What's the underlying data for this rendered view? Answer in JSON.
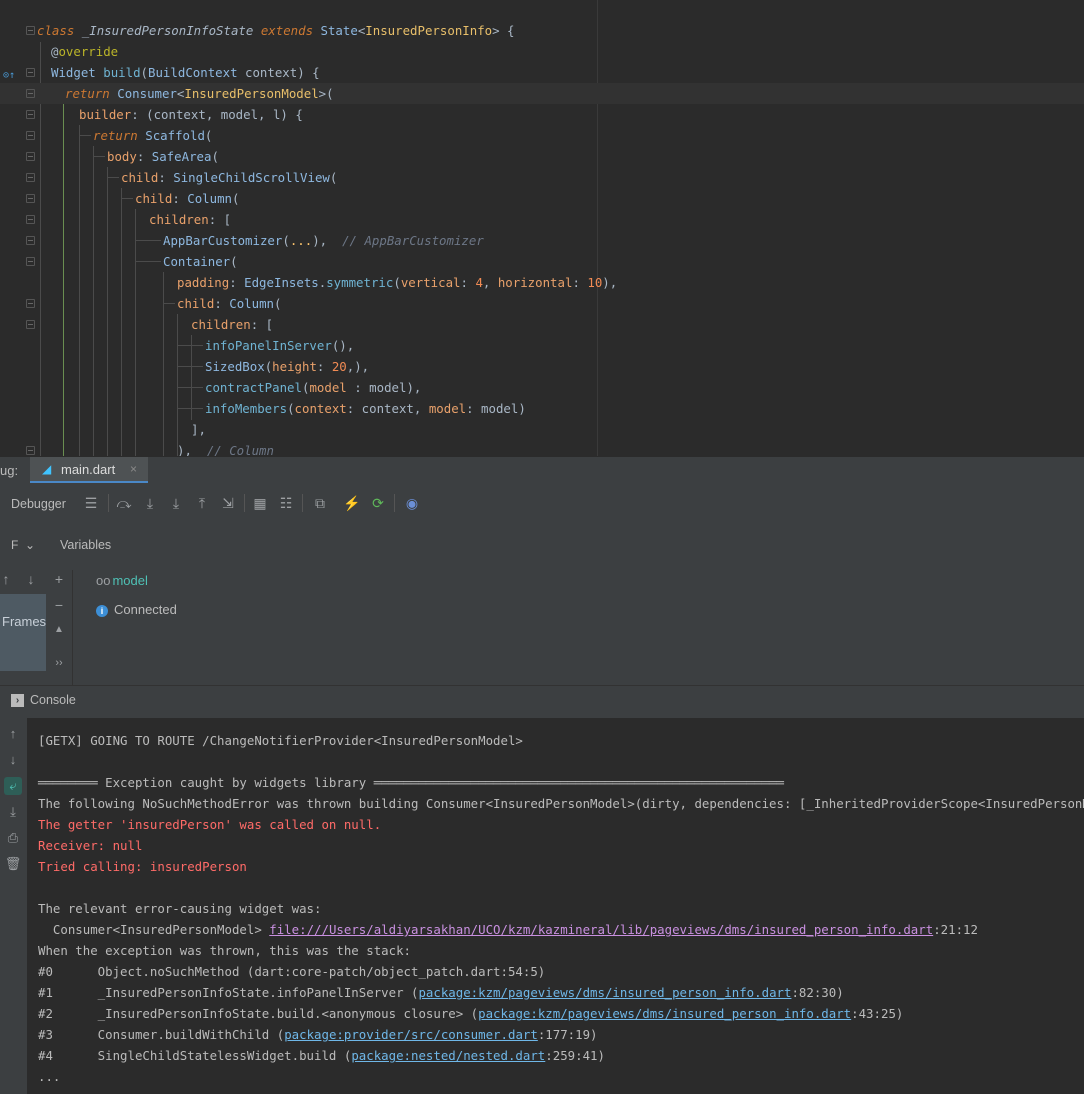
{
  "editor": {
    "lines": {
      "l1": {
        "kw": "class",
        "cls": "_InsuredPersonInfoState",
        "kw2": "extends",
        "ty": "State",
        "lt": "<",
        "tp": "InsuredPersonInfo",
        "rest": "> {"
      },
      "l2": {
        "at": "@",
        "an": "override"
      },
      "l3": {
        "ty": "Widget",
        "fn": "build",
        "rest1": "(",
        "ty2": "BuildContext",
        "rest2": " context) {"
      },
      "l4": {
        "kw": "return",
        "ty": "Consumer",
        "lt": "<",
        "tp": "InsuredPersonModel",
        "rest": ">("
      },
      "l5": {
        "prm": "builder",
        "rest": ": (context, model, l) {"
      },
      "l6": {
        "kw": "return",
        "ty": "Scaffold",
        "rest": "("
      },
      "l7": {
        "prm": "body",
        "rest": ": ",
        "ty": "SafeArea",
        "rest2": "("
      },
      "l8": {
        "prm": "child",
        "rest": ": ",
        "ty": "SingleChildScrollView",
        "rest2": "("
      },
      "l9": {
        "prm": "child",
        "rest": ": ",
        "ty": "Column",
        "rest2": "("
      },
      "l10": {
        "prm": "children",
        "rest": ": ["
      },
      "l11": {
        "ty": "AppBarCustomizer",
        "mid": "(",
        "dots": "...",
        "rest": "),",
        "cm": "// AppBarCustomizer"
      },
      "l12": {
        "ty": "Container",
        "rest": "("
      },
      "l13": {
        "prm": "padding",
        "rest": ": ",
        "ty": "EdgeInsets",
        "dot": ".",
        "fn": "symmetric",
        "p1": "(",
        "prm2": "vertical",
        "c1": ": ",
        "n1": "4",
        "c2": ", ",
        "prm3": "horizontal",
        "c3": ": ",
        "n2": "10",
        "end": "),"
      },
      "l14": {
        "prm": "child",
        "rest": ": ",
        "ty": "Column",
        "rest2": "("
      },
      "l15": {
        "prm": "children",
        "rest": ": ["
      },
      "l16": {
        "fn": "infoPanelInServer",
        "rest": "(),"
      },
      "l17": {
        "ty": "SizedBox",
        "p1": "(",
        "prm": "height",
        "c1": ": ",
        "n": "20",
        "rest": ",),"
      },
      "l18": {
        "fn": "contractPanel",
        "p1": "(",
        "prm": "model",
        "c1": " : model),",
        "rest": ""
      },
      "l19": {
        "fn": "infoMembers",
        "p1": "(",
        "prm": "context",
        "c1": ": context, ",
        "prm2": "model",
        "c2": ": model)"
      },
      "l20": {
        "rest": "],"
      },
      "l21": {
        "rest": "),",
        "cm": "// Column"
      }
    }
  },
  "debug_bar": {
    "label": "ug:",
    "tab_label": "main.dart",
    "close": "×"
  },
  "debugger": {
    "title": "Debugger",
    "variables_header": "Variables",
    "frames_dropdown": "F",
    "frames_tab": "Frames",
    "variables": [
      {
        "name": "model"
      },
      {
        "name": "Connected"
      }
    ]
  },
  "console": {
    "title": "Console",
    "lines": {
      "c1": "[GETX] GOING TO ROUTE /ChangeNotifierProvider<InsuredPersonModel>",
      "c2": "════════ Exception caught by widgets library ═══════════════════════════════════════════════════════",
      "c3": "The following NoSuchMethodError was thrown building Consumer<InsuredPersonModel>(dirty, dependencies: [_InheritedProviderScope<InsuredPersonModel>]):",
      "c4": "The getter 'insuredPerson' was called on null.",
      "c5": "Receiver: null",
      "c6": "Tried calling: insuredPerson",
      "c7": "The relevant error-causing widget was:",
      "c8a": "  Consumer<InsuredPersonModel> ",
      "c8b": "file:///Users/aldiyarsakhan/UCO/kzm/kazmineral/lib/pageviews/dms/insured_person_info.dart",
      "c8c": ":21:12",
      "c9": "When the exception was thrown, this was the stack:",
      "c10": "#0      Object.noSuchMethod (dart:core-patch/object_patch.dart:54:5)",
      "c11a": "#1      _InsuredPersonInfoState.infoPanelInServer (",
      "c11b": "package:kzm/pageviews/dms/insured_person_info.dart",
      "c11c": ":82:30)",
      "c12a": "#2      _InsuredPersonInfoState.build.<anonymous closure> (",
      "c12b": "package:kzm/pageviews/dms/insured_person_info.dart",
      "c12c": ":43:25)",
      "c13a": "#3      Consumer.buildWithChild (",
      "c13b": "package:provider/src/consumer.dart",
      "c13c": ":177:19)",
      "c14a": "#4      SingleChildStatelessWidget.build (",
      "c14b": "package:nested/nested.dart",
      "c14c": ":259:41)",
      "c15": "..."
    }
  },
  "colors": {
    "background": "#2b2b2b",
    "panel": "#3c3f41",
    "error": "#ff6b68",
    "accent": "#4a88c7"
  }
}
